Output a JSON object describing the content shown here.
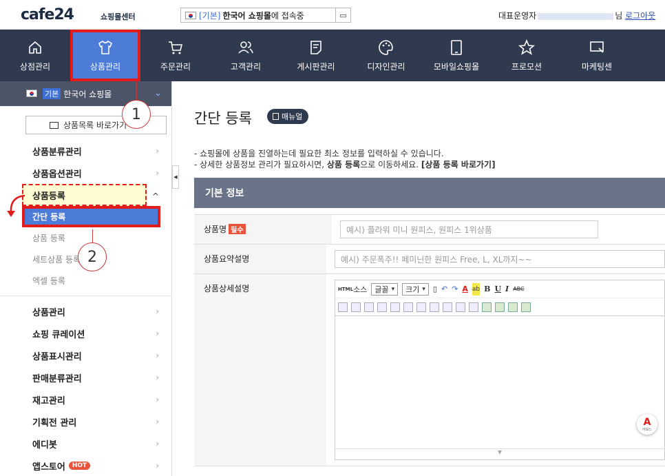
{
  "topbar": {
    "logo": "cafe24",
    "logo_sub": "쇼핑몰센터",
    "connect_tag": "[기본]",
    "connect_name": "한국어 쇼핑몰",
    "connect_rest": "에 접속중",
    "admin_label": "대표운영자",
    "admin_suffix": "님",
    "logout": "로그아웃"
  },
  "nav": [
    {
      "label": "상점관리",
      "icon": "home-icon"
    },
    {
      "label": "상품관리",
      "icon": "shirt-icon"
    },
    {
      "label": "주문관리",
      "icon": "cart-icon"
    },
    {
      "label": "고객관리",
      "icon": "users-icon"
    },
    {
      "label": "게시판관리",
      "icon": "board-icon"
    },
    {
      "label": "디자인관리",
      "icon": "palette-icon"
    },
    {
      "label": "모바일쇼핑몰",
      "icon": "mobile-icon"
    },
    {
      "label": "프로모션",
      "icon": "star-icon"
    },
    {
      "label": "마케팅센",
      "icon": "marketing-icon"
    }
  ],
  "sidebar": {
    "mall_badge": "기본",
    "mall_name": "한국어 쇼핑몰",
    "list_button": "상품목록 바로가기",
    "menu_top": [
      "상품분류관리",
      "상품옵션관리"
    ],
    "open_group": "상품등록",
    "sub_items": [
      "간단 등록",
      "상품 등록",
      "세트상품 등록",
      "엑셀 등록"
    ],
    "menu_bottom": [
      "상품관리",
      "쇼핑 큐레이션",
      "상품표시관리",
      "판매분류관리",
      "재고관리",
      "기획전 관리",
      "에디봇",
      "앱스토어"
    ],
    "hot_badge": "HOT"
  },
  "callouts": [
    "1",
    "2"
  ],
  "content": {
    "title": "간단 등록",
    "manual": "매뉴얼",
    "desc1": "- 쇼핑몰에 상품을 진열하는데 필요한 최소 정보를 입력하실 수 있습니다.",
    "desc2_a": "- 상세한 상품정보 관리가 필요하시면, ",
    "desc2_b": "상품 등록",
    "desc2_c": "으로 이동하세요. ",
    "desc2_d": "[상품 등록 바로가기]",
    "section": "기본 정보",
    "fields": [
      {
        "label": "상품명",
        "required": "필수",
        "placeholder": "예시) 플라워 미니 원피스, 원피스 1위상품"
      },
      {
        "label": "상품요약설명",
        "placeholder": "예시) 주문폭주!! 페미닌한 원피스 Free, L, XL까지~~"
      },
      {
        "label": "상품상세설명"
      }
    ],
    "editor": {
      "source": "소스",
      "html": "HTML",
      "font_select": "글꼴",
      "size_select": "크기",
      "bold": "B",
      "underline": "U",
      "italic": "I",
      "strike": "ABC",
      "badge_sub": "아보느"
    }
  }
}
